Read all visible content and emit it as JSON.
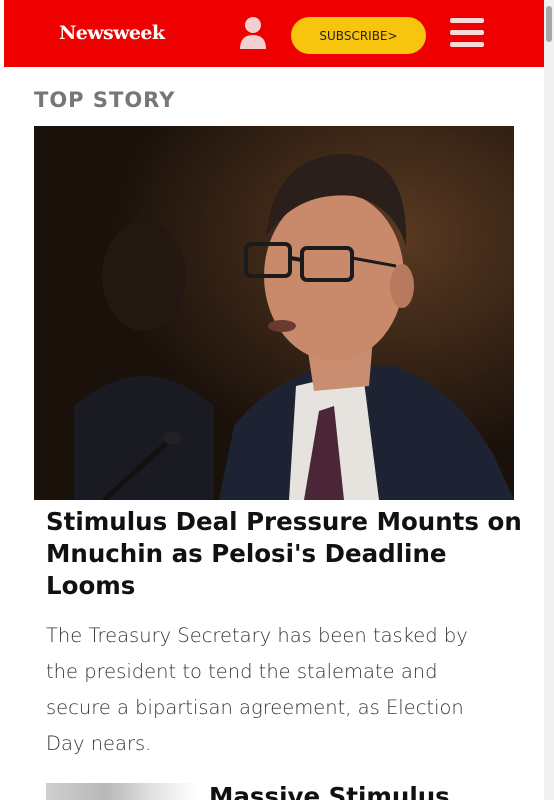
{
  "header": {
    "logo": "Newsweek",
    "subscribe_label": "SUBSCRIBE",
    "subscribe_arrow": ">",
    "brand_color": "#ef0000",
    "subscribe_color": "#f7c50e"
  },
  "top_story": {
    "section_label": "TOP STORY",
    "headline": "Stimulus Deal Pressure Mounts on Mnuchin as Pelosi's Deadline Looms",
    "summary": "The Treasury Secretary has been tasked by the president to tend the stalemate and secure a bipartisan agreement, as Election Day nears."
  },
  "next_story": {
    "headline_partial": "Massive Stimulus"
  },
  "icons": {
    "account": "user-icon",
    "menu": "hamburger-menu-icon"
  }
}
